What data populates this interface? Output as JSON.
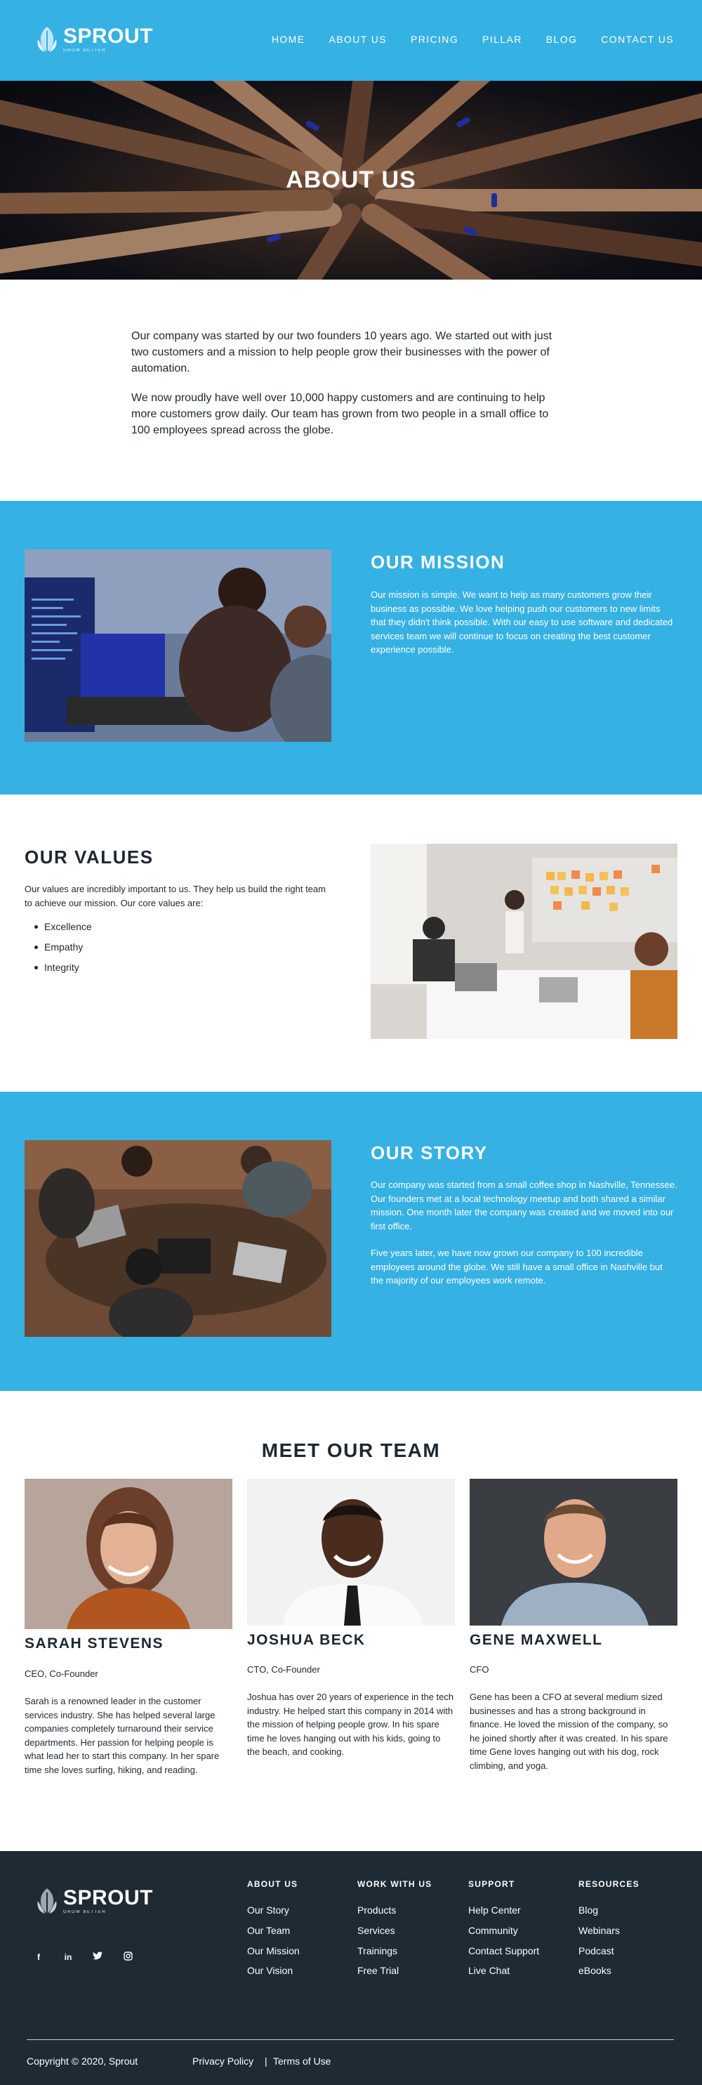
{
  "brand": {
    "name": "SPROUT",
    "tagline": "GROW BETTER"
  },
  "nav": {
    "items": [
      "HOME",
      "ABOUT US",
      "PRICING",
      "PILLAR",
      "BLOG",
      "CONTACT US"
    ]
  },
  "hero": {
    "title": "ABOUT US"
  },
  "intro": {
    "p1": "Our company was started by our two founders 10 years ago. We started out with just two customers and a mission to help people grow their businesses with the power of automation.",
    "p2": "We now proudly have well over 10,000 happy customers and are continuing to help more customers grow daily. Our team has grown from two people in a small office to 100 employees spread across the globe."
  },
  "mission": {
    "title": "OUR MISSION",
    "text": "Our mission is simple. We want to help as many customers grow their business as possible. We love helping push our customers to new limits that they didn't think possible. With our easy to use software and dedicated services team we will continue to focus on creating the best customer experience possible."
  },
  "values": {
    "title": "OUR VALUES",
    "text": "Our values are incredibly important to us. They help us build the right team to achieve our mission. Our core values are:",
    "items": [
      "Excellence",
      "Empathy",
      "Integrity"
    ]
  },
  "story": {
    "title": "OUR STORY",
    "p1": "Our company was started from a small coffee shop in Nashville, Tennessee. Our founders met at a local technology meetup and both shared a similar mission. One month later the company was created and we moved into our first office.",
    "p2": "Five years later, we have now grown our company to 100 incredible employees around the globe. We still have a small office in Nashville but the majority of our employees work remote."
  },
  "team": {
    "title": "MEET OUR TEAM",
    "members": [
      {
        "name": "SARAH STEVENS",
        "role": "CEO, Co-Founder",
        "bio": "Sarah is a renowned leader in the customer services industry. She has helped several large companies completely turnaround their service departments. Her passion for helping people is what lead her to start this company. In her spare time she loves surfing, hiking, and reading."
      },
      {
        "name": "JOSHUA BECK",
        "role": "CTO, Co-Founder",
        "bio": "Joshua has over 20 years of experience in the tech industry. He helped start this company in 2014 with the mission of helping people grow. In his spare time he loves hanging out with his kids, going to the beach, and cooking."
      },
      {
        "name": "GENE MAXWELL",
        "role": "CFO",
        "bio": "Gene has been a CFO at several medium sized businesses and has a strong background in finance. He loved the mission of the company, so he joined shortly after it was created. In his spare time Gene loves hanging out with his dog, rock climbing, and yoga."
      }
    ]
  },
  "footer": {
    "social": [
      "f",
      "in",
      "t",
      "ig"
    ],
    "columns": [
      {
        "title": "ABOUT US",
        "links": [
          "Our Story",
          "Our Team",
          "Our Mission",
          "Our Vision"
        ]
      },
      {
        "title": "WORK WITH US",
        "links": [
          "Products",
          "Services",
          "Trainings",
          "Free Trial"
        ]
      },
      {
        "title": "SUPPORT",
        "links": [
          "Help Center",
          "Community",
          "Contact Support",
          "Live Chat"
        ]
      },
      {
        "title": "RESOURCES",
        "links": [
          "Blog",
          "Webinars",
          "Podcast",
          "eBooks"
        ]
      }
    ],
    "copyright": "Copyright © 2020, Sprout",
    "privacy": "Privacy Policy",
    "separator": "|",
    "terms": "Terms of Use"
  },
  "colors": {
    "primary": "#36b1e3",
    "footer": "#1e2a34",
    "text": "#1d2731"
  }
}
